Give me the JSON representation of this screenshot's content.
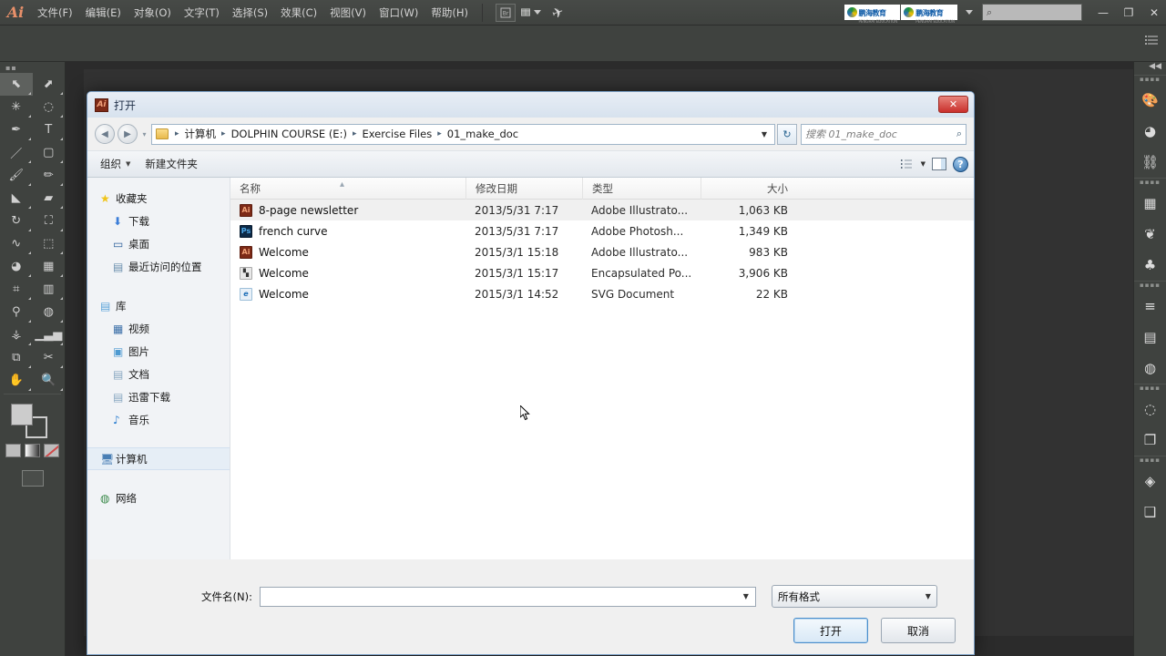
{
  "app": {
    "logo": "Ai",
    "menus": [
      {
        "label": "文件(F)",
        "name": "menu-file"
      },
      {
        "label": "编辑(E)",
        "name": "menu-edit"
      },
      {
        "label": "对象(O)",
        "name": "menu-object"
      },
      {
        "label": "文字(T)",
        "name": "menu-type"
      },
      {
        "label": "选择(S)",
        "name": "menu-select"
      },
      {
        "label": "效果(C)",
        "name": "menu-effect"
      },
      {
        "label": "视图(V)",
        "name": "menu-view"
      },
      {
        "label": "窗口(W)",
        "name": "menu-window"
      },
      {
        "label": "帮助(H)",
        "name": "menu-help"
      }
    ],
    "brand": {
      "text1": "鹏海教育",
      "text2": "鹏海教育",
      "sub": "PENGHAI EDUCATION"
    },
    "search_placeholder": "",
    "window_buttons": {
      "minimize": "—",
      "maximize": "❐",
      "close": "✕"
    }
  },
  "toolpanel": {
    "tools": [
      {
        "name": "selection-tool",
        "glyph": "⬉",
        "active": true
      },
      {
        "name": "direct-selection-tool",
        "glyph": "⬈",
        "active": false
      },
      {
        "name": "magic-wand-tool",
        "glyph": "✳",
        "active": false
      },
      {
        "name": "lasso-tool",
        "glyph": "◌",
        "active": false
      },
      {
        "name": "pen-tool",
        "glyph": "✒",
        "active": false
      },
      {
        "name": "type-tool",
        "glyph": "T",
        "active": false
      },
      {
        "name": "line-segment-tool",
        "glyph": "／",
        "active": false
      },
      {
        "name": "rectangle-tool",
        "glyph": "▢",
        "active": false
      },
      {
        "name": "paintbrush-tool",
        "glyph": "🖌",
        "active": false
      },
      {
        "name": "pencil-tool",
        "glyph": "✏",
        "active": false
      },
      {
        "name": "blob-brush-tool",
        "glyph": "◣",
        "active": false
      },
      {
        "name": "eraser-tool",
        "glyph": "▰",
        "active": false
      },
      {
        "name": "rotate-tool",
        "glyph": "↻",
        "active": false
      },
      {
        "name": "scale-tool",
        "glyph": "⛶",
        "active": false
      },
      {
        "name": "width-tool",
        "glyph": "∿",
        "active": false
      },
      {
        "name": "free-transform-tool",
        "glyph": "⬚",
        "active": false
      },
      {
        "name": "shape-builder-tool",
        "glyph": "◕",
        "active": false
      },
      {
        "name": "perspective-grid-tool",
        "glyph": "▦",
        "active": false
      },
      {
        "name": "mesh-tool",
        "glyph": "⌗",
        "active": false
      },
      {
        "name": "gradient-tool",
        "glyph": "▥",
        "active": false
      },
      {
        "name": "eyedropper-tool",
        "glyph": "⚲",
        "active": false
      },
      {
        "name": "blend-tool",
        "glyph": "◍",
        "active": false
      },
      {
        "name": "symbol-sprayer-tool",
        "glyph": "⚶",
        "active": false
      },
      {
        "name": "column-graph-tool",
        "glyph": "▁▃▅",
        "active": false
      },
      {
        "name": "artboard-tool",
        "glyph": "⧉",
        "active": false
      },
      {
        "name": "slice-tool",
        "glyph": "✂",
        "active": false
      },
      {
        "name": "hand-tool",
        "glyph": "✋",
        "active": false
      },
      {
        "name": "zoom-tool",
        "glyph": "🔍",
        "active": false
      }
    ],
    "fill_label": "fill-swatch",
    "stroke_label": "stroke-swatch"
  },
  "rightdock": {
    "collapse": "◀◀",
    "groups": [
      {
        "icons": [
          {
            "name": "color-panel-icon",
            "glyph": "🎨"
          },
          {
            "name": "color-guide-panel-icon",
            "glyph": "◕"
          },
          {
            "name": "symbols-panel-icon",
            "glyph": "⛓"
          }
        ]
      },
      {
        "icons": [
          {
            "name": "swatches-panel-icon",
            "glyph": "▦"
          },
          {
            "name": "brushes-panel-icon",
            "glyph": "❦"
          },
          {
            "name": "graphic-styles-panel-icon",
            "glyph": "♣"
          }
        ]
      },
      {
        "icons": [
          {
            "name": "align-panel-icon",
            "glyph": "≡"
          },
          {
            "name": "gradient-panel-icon",
            "glyph": "▤"
          },
          {
            "name": "transparency-panel-icon",
            "glyph": "◍"
          }
        ]
      },
      {
        "icons": [
          {
            "name": "stroke-panel-icon",
            "glyph": "◌"
          },
          {
            "name": "pathfinder-panel-icon",
            "glyph": "❐"
          }
        ]
      },
      {
        "icons": [
          {
            "name": "layers-panel-icon",
            "glyph": "◈"
          },
          {
            "name": "artboards-panel-icon",
            "glyph": "❑"
          }
        ]
      }
    ]
  },
  "dialog": {
    "title": "打开",
    "title_icon": "Ai",
    "close_label": "✕",
    "nav": {
      "back": "◀",
      "forward": "▶",
      "breadcrumb": [
        "计算机",
        "DOLPHIN COURSE (E:)",
        "Exercise Files",
        "01_make_doc"
      ],
      "separator": "▸",
      "dropdown_caret": "▼",
      "refresh": "↻",
      "search_placeholder": "搜索 01_make_doc",
      "search_value": "",
      "search_icon": "⌕"
    },
    "toolbar": {
      "organize": "组织",
      "new_folder": "新建文件夹",
      "caret": "▼",
      "view_icon": "☰",
      "preview_icon": "▣",
      "help_icon": "?"
    },
    "sidebar": [
      {
        "label": "收藏夹",
        "icon": "★",
        "level": "root",
        "name": "sidebar-favorites",
        "color": "#f0c419"
      },
      {
        "label": "下载",
        "icon": "⬇",
        "level": "child",
        "name": "sidebar-downloads",
        "color": "#3b7dd8"
      },
      {
        "label": "桌面",
        "icon": "▭",
        "level": "child",
        "name": "sidebar-desktop",
        "color": "#2d5f9a"
      },
      {
        "label": "最近访问的位置",
        "icon": "▤",
        "level": "child",
        "name": "sidebar-recent-places",
        "color": "#6b8fae"
      },
      {
        "label": "库",
        "icon": "▤",
        "level": "root",
        "name": "sidebar-libraries",
        "color": "#5ba3d9"
      },
      {
        "label": "视频",
        "icon": "▦",
        "level": "child",
        "name": "sidebar-videos",
        "color": "#3b6fa8"
      },
      {
        "label": "图片",
        "icon": "▣",
        "level": "child",
        "name": "sidebar-pictures",
        "color": "#4e9ad1"
      },
      {
        "label": "文档",
        "icon": "▤",
        "level": "child",
        "name": "sidebar-documents",
        "color": "#8aa8c2"
      },
      {
        "label": "迅雷下载",
        "icon": "▤",
        "level": "child",
        "name": "sidebar-thunder-downloads",
        "color": "#8aa8c2"
      },
      {
        "label": "音乐",
        "icon": "♪",
        "level": "child",
        "name": "sidebar-music",
        "color": "#2d7fd0"
      },
      {
        "label": "计算机",
        "icon": "🖥",
        "level": "root",
        "name": "sidebar-computer",
        "color": "#4a7fb5",
        "selected": true
      },
      {
        "label": "网络",
        "icon": "◍",
        "level": "root",
        "name": "sidebar-network",
        "color": "#3b8a4a"
      }
    ],
    "columns": [
      "名称",
      "修改日期",
      "类型",
      "大小"
    ],
    "files": [
      {
        "name": "8-page newsletter",
        "date": "2013/5/31 7:17",
        "type": "Adobe Illustrato...",
        "size": "1,063 KB",
        "icon": "ai",
        "glyph": "Ai",
        "hover": true
      },
      {
        "name": "french curve",
        "date": "2013/5/31 7:17",
        "type": "Adobe Photosh...",
        "size": "1,349 KB",
        "icon": "ps",
        "glyph": "Ps",
        "hover": false
      },
      {
        "name": "Welcome",
        "date": "2015/3/1 15:18",
        "type": "Adobe Illustrato...",
        "size": "983 KB",
        "icon": "ai",
        "glyph": "Ai",
        "hover": false
      },
      {
        "name": "Welcome",
        "date": "2015/3/1 15:17",
        "type": "Encapsulated Po...",
        "size": "3,906 KB",
        "icon": "eps",
        "glyph": "▚",
        "hover": false
      },
      {
        "name": "Welcome",
        "date": "2015/3/1 14:52",
        "type": "SVG Document",
        "size": "22 KB",
        "icon": "svg",
        "glyph": "e",
        "hover": false
      }
    ],
    "footer": {
      "filename_label": "文件名(N):",
      "filename_value": "",
      "filename_caret": "▼",
      "filetype_value": "所有格式",
      "filetype_caret": "▼",
      "open_button": "打开",
      "cancel_button": "取消"
    }
  }
}
